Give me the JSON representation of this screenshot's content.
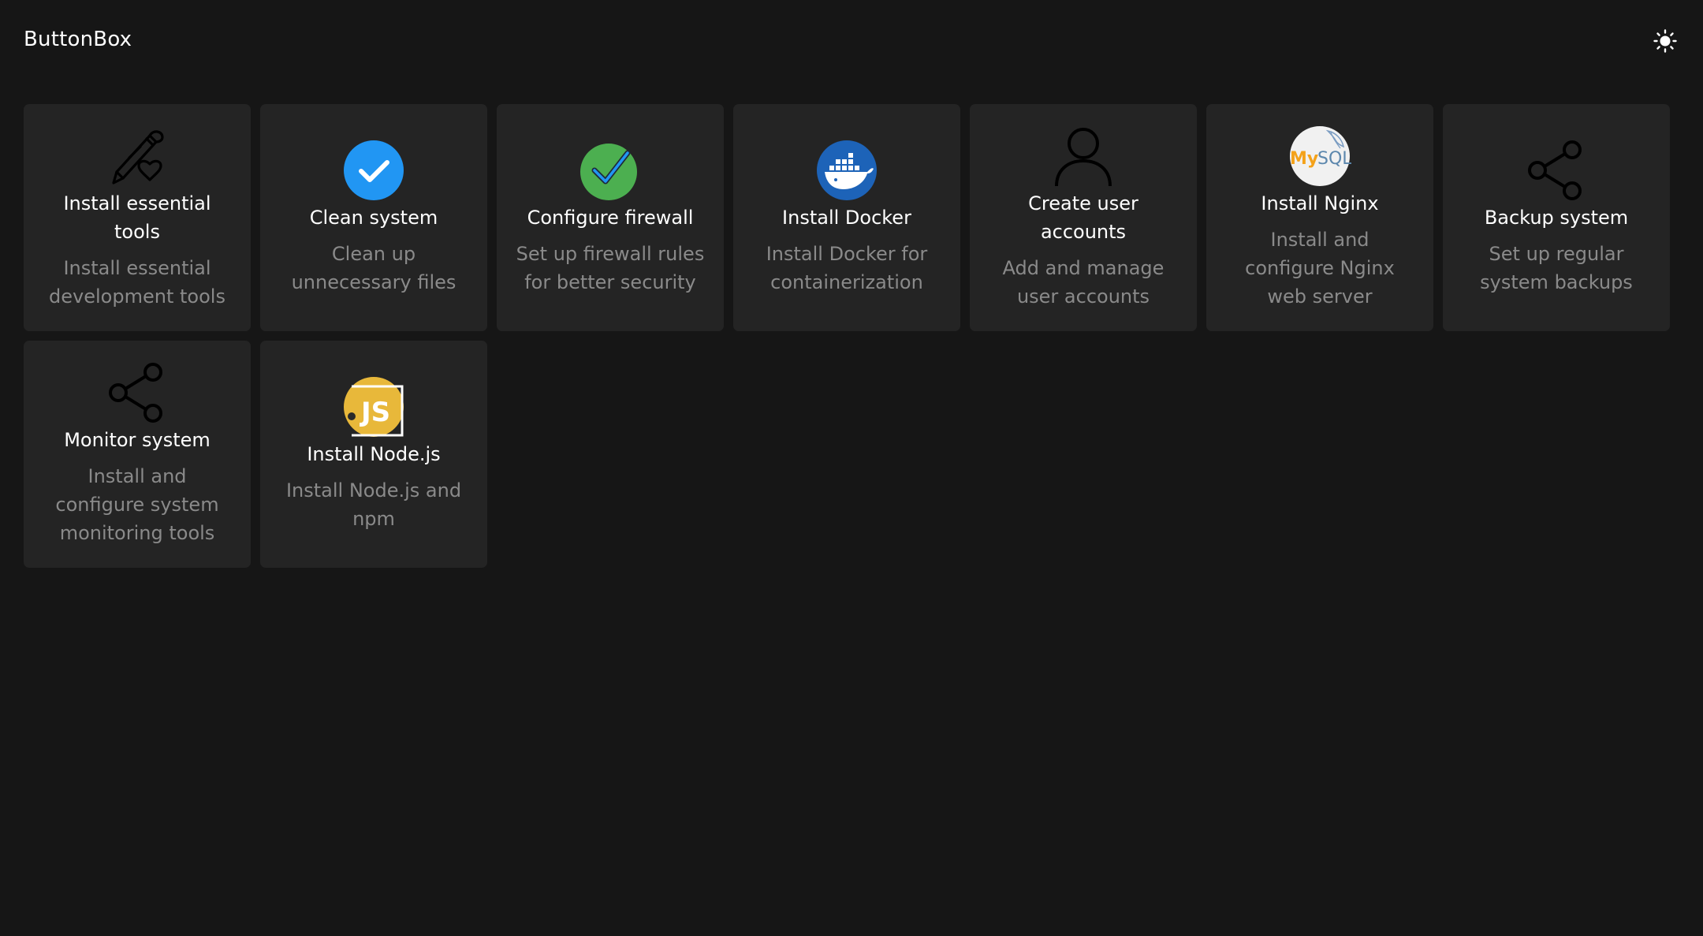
{
  "app": {
    "title": "ButtonBox",
    "theme_toggle_icon": "sun-icon"
  },
  "colors": {
    "background": "#161616",
    "card": "#242424",
    "title": "#ffffff",
    "description": "#8a8a8a",
    "accent_blue": "#2196f3",
    "accent_green": "#4caf50",
    "docker_blue": "#1d63b8",
    "node_yellow": "#e8b83a"
  },
  "cards": [
    {
      "title": "Install essential tools",
      "description": "Install essential development tools",
      "icon": "pen-heart-icon"
    },
    {
      "title": "Clean system",
      "description": "Clean up unnecessary files",
      "icon": "check-circle-icon"
    },
    {
      "title": "Configure firewall",
      "description": "Set up firewall rules for better security",
      "icon": "double-check-icon"
    },
    {
      "title": "Install Docker",
      "description": "Install Docker for containerization",
      "icon": "docker-icon"
    },
    {
      "title": "Create user accounts",
      "description": "Add and manage user accounts",
      "icon": "user-icon"
    },
    {
      "title": "Install Nginx",
      "description": "Install and configure Nginx web server",
      "icon": "mysql-icon",
      "icon_text": "MySQL"
    },
    {
      "title": "Backup system",
      "description": "Set up regular system backups",
      "icon": "share-icon"
    },
    {
      "title": "Monitor system",
      "description": "Install and configure system monitoring tools",
      "icon": "share-icon"
    },
    {
      "title": "Install Node.js",
      "description": "Install Node.js and npm",
      "icon": "nodejs-icon",
      "icon_text": "JS"
    }
  ]
}
